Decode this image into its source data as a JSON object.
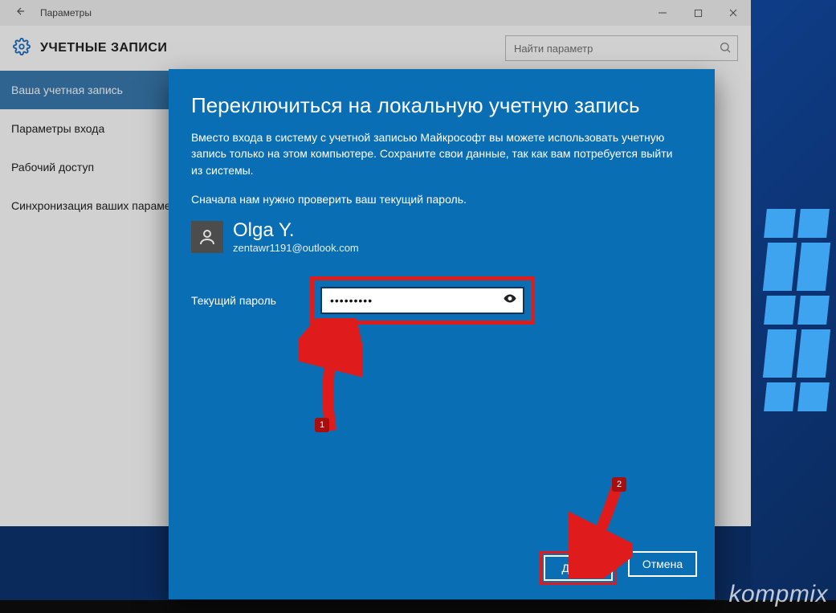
{
  "window": {
    "title": "Параметры",
    "header": "УЧЕТНЫЕ ЗАПИСИ",
    "search_placeholder": "Найти параметр"
  },
  "sidebar": {
    "items": [
      {
        "label": "Ваша учетная запись",
        "selected": true
      },
      {
        "label": "Параметры входа",
        "selected": false
      },
      {
        "label": "Рабочий доступ",
        "selected": false
      },
      {
        "label": "Синхронизация ваших параметров",
        "selected": false
      }
    ]
  },
  "dialog": {
    "title": "Переключиться на локальную учетную запись",
    "description": "Вместо входа в систему с учетной записью Майкрософт вы можете использовать учетную запись только на этом компьютере. Сохраните свои данные, так как вам потребуется выйти из системы.",
    "note": "Сначала нам нужно проверить ваш текущий пароль.",
    "user": {
      "name": "Olga Y.",
      "email": "zentawr1191@outlook.com"
    },
    "password_label": "Текущий пароль",
    "password_value": "•••••••••",
    "next_label": "Далее",
    "cancel_label": "Отмена"
  },
  "annotations": {
    "mark1": "1",
    "mark2": "2"
  },
  "watermark": "kompmix",
  "colors": {
    "dialog_bg": "#0a6eb4",
    "highlight": "#e01b1b"
  }
}
